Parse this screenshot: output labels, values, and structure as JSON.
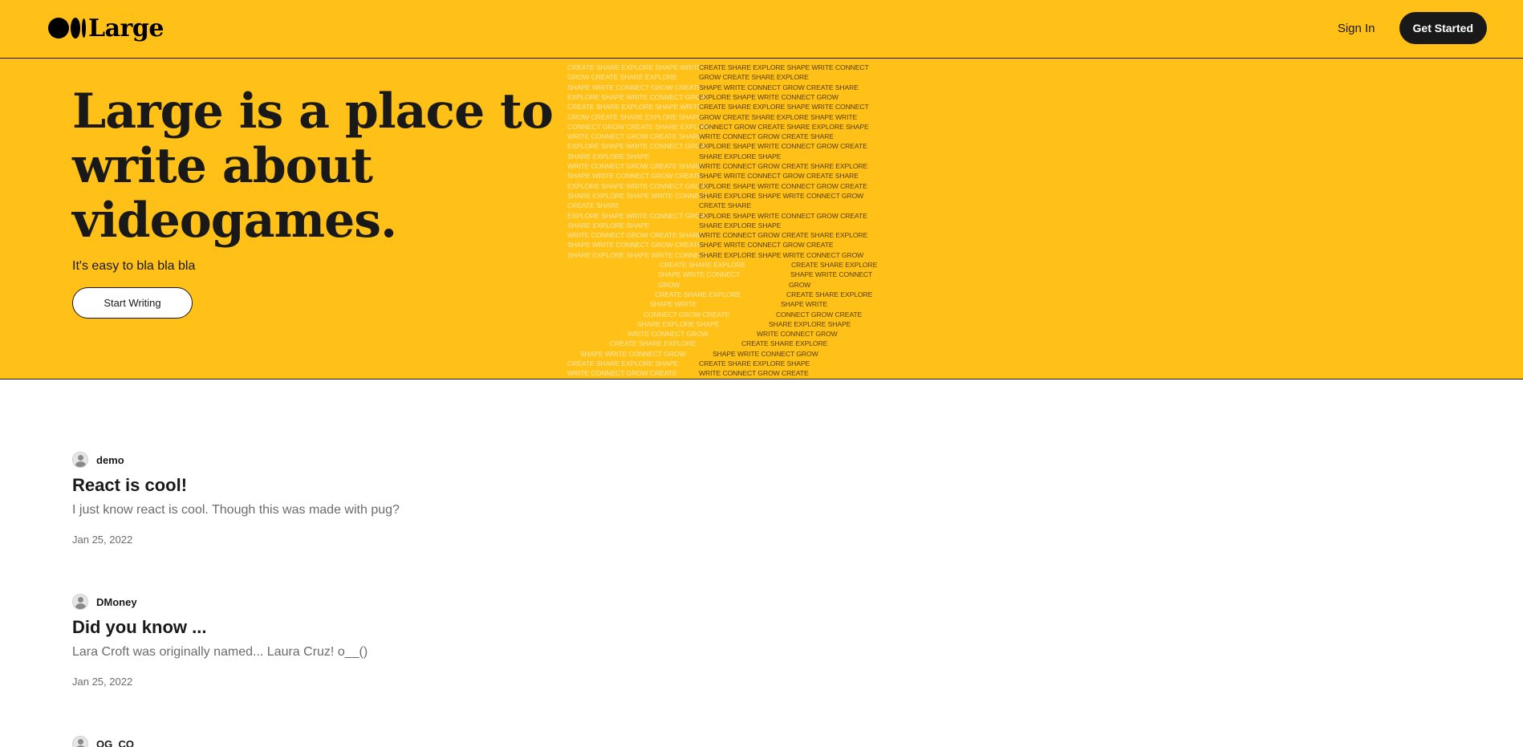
{
  "header": {
    "logo_text": "Large",
    "sign_in_label": "Sign In",
    "get_started_label": "Get Started"
  },
  "hero": {
    "title": "Large is a place to write about videogames.",
    "subtitle": "It's easy to bla bla bla",
    "cta_label": "Start Writing",
    "art_lines_left": [
      "CREATE SHARE EXPLORE SHAPE WRITE",
      "GROW CREATE SHARE EXPLORE",
      "SHAPE WRITE CONNECT GROW CREATE",
      "EXPLORE SHAPE WRITE CONNECT GROW",
      "CREATE SHARE EXPLORE SHAPE WRITE",
      "GROW CREATE SHARE EXPLORE SHAPE",
      "CONNECT GROW CREATE SHARE EXPLORE",
      "WRITE CONNECT GROW CREATE SHARE",
      "EXPLORE SHAPE WRITE CONNECT GROW",
      "SHARE EXPLORE SHAPE",
      "WRITE CONNECT GROW CREATE SHARE",
      "SHAPE WRITE CONNECT GROW CREATE",
      "EXPLORE SHAPE WRITE CONNECT GROW",
      "SHARE EXPLORE SHAPE WRITE CONNECT",
      "CREATE SHARE",
      "EXPLORE SHAPE WRITE CONNECT GROW",
      "SHARE EXPLORE SHAPE",
      "WRITE CONNECT GROW CREATE SHARE",
      "SHAPE WRITE CONNECT GROW CREATE",
      "SHARE EXPLORE SHAPE WRITE CONNECT"
    ],
    "art_lines_right": [
      "CREATE SHARE EXPLORE SHAPE WRITE CONNECT",
      "GROW CREATE SHARE EXPLORE",
      "SHAPE WRITE CONNECT GROW CREATE SHARE",
      "EXPLORE SHAPE WRITE CONNECT GROW",
      "CREATE SHARE EXPLORE SHAPE WRITE CONNECT",
      "GROW CREATE SHARE EXPLORE SHAPE WRITE",
      "CONNECT GROW CREATE SHARE EXPLORE SHAPE",
      "WRITE CONNECT GROW CREATE SHARE",
      "EXPLORE SHAPE WRITE CONNECT GROW CREATE",
      "SHARE EXPLORE SHAPE",
      "WRITE CONNECT GROW CREATE SHARE EXPLORE",
      "SHAPE WRITE CONNECT GROW CREATE SHARE",
      "EXPLORE SHAPE WRITE CONNECT GROW CREATE",
      "SHARE EXPLORE SHAPE WRITE CONNECT GROW",
      "CREATE SHARE",
      "EXPLORE SHAPE WRITE CONNECT GROW CREATE",
      "SHARE EXPLORE SHAPE",
      "WRITE CONNECT GROW CREATE SHARE EXPLORE",
      "SHAPE WRITE CONNECT GROW CREATE",
      "SHARE EXPLORE SHAPE WRITE CONNECT GROW"
    ],
    "art_lines_left_lower": [
      "CREATE SHARE EXPLORE",
      "SHAPE WRITE CONNECT",
      "GROW",
      "CREATE SHARE EXPLORE",
      "SHAPE WRITE",
      "CONNECT GROW CREATE",
      "SHARE EXPLORE SHAPE",
      "WRITE CONNECT GROW",
      "CREATE SHARE EXPLORE",
      "SHAPE WRITE CONNECT GROW",
      "CREATE SHARE EXPLORE SHAPE",
      "WRITE CONNECT GROW CREATE"
    ],
    "art_lines_right_lower": [
      "CREATE SHARE EXPLORE",
      "SHAPE WRITE CONNECT",
      "GROW",
      "CREATE SHARE EXPLORE",
      "SHAPE WRITE",
      "CONNECT GROW CREATE",
      "SHARE EXPLORE SHAPE",
      "WRITE CONNECT GROW",
      "CREATE SHARE EXPLORE",
      "SHAPE WRITE CONNECT GROW",
      "CREATE SHARE EXPLORE SHAPE",
      "WRITE CONNECT GROW CREATE"
    ]
  },
  "articles": [
    {
      "author": "demo",
      "title": "React is cool!",
      "snippet": "I just know react is cool. Though this was made with pug?",
      "date": "Jan 25, 2022"
    },
    {
      "author": "DMoney",
      "title": "Did you know ...",
      "snippet": "Lara Croft was originally named... Laura Cruz! o__()",
      "date": "Jan 25, 2022"
    },
    {
      "author": "OG_CO"
    }
  ]
}
